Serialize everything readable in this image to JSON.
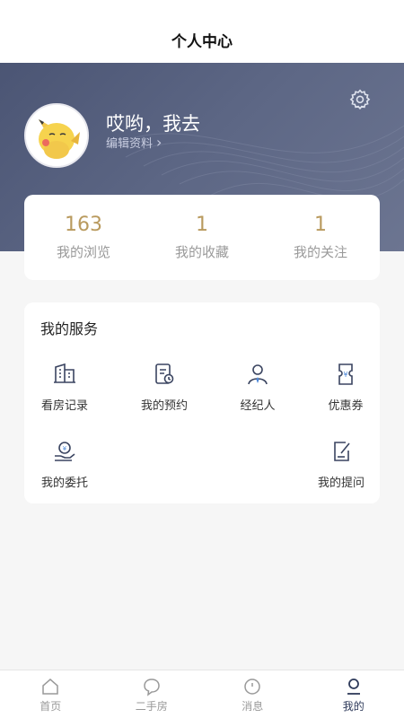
{
  "nav": {
    "title": "个人中心"
  },
  "profile": {
    "username": "哎哟，我去",
    "edit_label": "编辑资料",
    "edit_chevron": "›"
  },
  "stats": [
    {
      "value": "163",
      "label": "我的浏览"
    },
    {
      "value": "1",
      "label": "我的收藏"
    },
    {
      "value": "1",
      "label": "我的关注"
    }
  ],
  "services": {
    "title": "我的服务",
    "items": [
      {
        "label": "看房记录",
        "icon": "building-record-icon"
      },
      {
        "label": "我的预约",
        "icon": "appointment-icon"
      },
      {
        "label": "经纪人",
        "icon": "agent-icon"
      },
      {
        "label": "优惠券",
        "icon": "coupon-icon"
      },
      {
        "label": "我的委托",
        "icon": "entrust-icon"
      },
      {
        "label": "我的提问",
        "icon": "question-edit-icon"
      }
    ]
  },
  "tabs": [
    {
      "label": "首页",
      "icon": "home-icon",
      "active": false
    },
    {
      "label": "二手房",
      "icon": "chat-bubble-icon",
      "active": false
    },
    {
      "label": "消息",
      "icon": "message-clock-icon",
      "active": false
    },
    {
      "label": "我的",
      "icon": "profile-icon",
      "active": true
    }
  ],
  "colors": {
    "header_bg": "#555f7e",
    "stat_value": "#b99a5e",
    "icon_stroke": "#3a4460",
    "tab_active": "#2e3a5a",
    "tab_inactive": "#999999"
  }
}
